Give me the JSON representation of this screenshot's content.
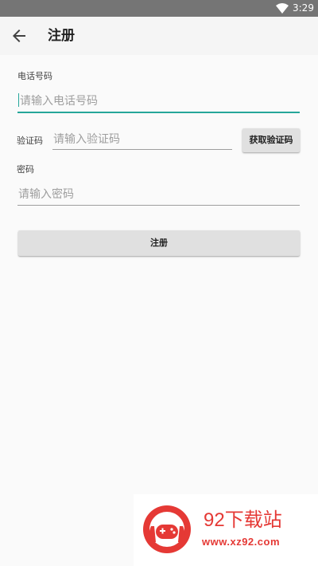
{
  "status_bar": {
    "time": "3:29",
    "wifi_icon": "wifi-icon"
  },
  "app_bar": {
    "back_icon": "arrow-back-icon",
    "title": "注册"
  },
  "form": {
    "phone_label": "电话号码",
    "phone_placeholder": "请输入电话号码",
    "code_label": "验证码",
    "code_placeholder": "请输入验证码",
    "get_code_button": "获取验证码",
    "password_label": "密码",
    "password_placeholder": "请输入密码",
    "register_button": "注册"
  },
  "watermark": {
    "brand": "92下载站",
    "site": "www.xz92.com"
  },
  "colors": {
    "accent": "#26a69a",
    "status_bar": "#757575",
    "watermark": "#e53935"
  }
}
